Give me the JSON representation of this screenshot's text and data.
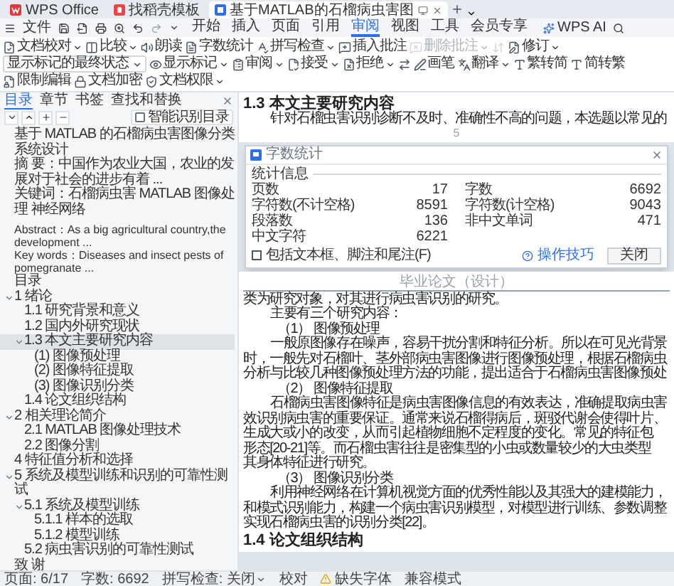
{
  "tabs": [
    {
      "kind": "home",
      "label": "WPS Office",
      "selected": false
    },
    {
      "kind": "template",
      "label": "找稻壳模板",
      "selected": false
    },
    {
      "kind": "doc",
      "label": "基于MATLAB的石榴病虫害图",
      "selected": true
    }
  ],
  "menu": {
    "file": "文件",
    "tabs": [
      {
        "label": "开始",
        "selected": false
      },
      {
        "label": "插入",
        "selected": false
      },
      {
        "label": "页面",
        "selected": false
      },
      {
        "label": "引用",
        "selected": false
      },
      {
        "label": "审阅",
        "selected": true
      },
      {
        "label": "视图",
        "selected": false
      },
      {
        "label": "工具",
        "selected": false
      },
      {
        "label": "会员专享",
        "selected": false
      }
    ],
    "ai": "WPS AI"
  },
  "ribbon": {
    "items": [
      {
        "kind": "button",
        "label": "文档校对",
        "dropdown": true,
        "disabled": false
      },
      {
        "kind": "button",
        "label": "比较",
        "dropdown": true,
        "disabled": false
      },
      {
        "kind": "button",
        "label": "朗读",
        "dropdown": false,
        "disabled": false
      },
      {
        "kind": "button",
        "label": "字数统计",
        "dropdown": false,
        "disabled": false
      },
      {
        "kind": "button",
        "label": "拼写检查",
        "dropdown": true,
        "disabled": false
      },
      {
        "kind": "button",
        "label": "插入批注",
        "dropdown": false,
        "disabled": false
      },
      {
        "kind": "button",
        "label": "删除批注",
        "dropdown": true,
        "disabled": true
      },
      {
        "kind": "icon",
        "disabled": true
      },
      {
        "kind": "button",
        "label": "修订",
        "dropdown": true,
        "disabled": false
      },
      {
        "kind": "select",
        "label": "显示标记的最终状态",
        "dropdown": true,
        "disabled": false
      },
      {
        "kind": "button",
        "label": "显示标记",
        "dropdown": true,
        "disabled": false
      },
      {
        "kind": "button",
        "label": "审阅",
        "dropdown": true,
        "disabled": false
      },
      {
        "kind": "button",
        "label": "接受",
        "dropdown": true,
        "disabled": false
      },
      {
        "kind": "button",
        "label": "拒绝",
        "dropdown": true,
        "disabled": false
      },
      {
        "kind": "icon",
        "disabled": false
      },
      {
        "kind": "button",
        "label": "画笔",
        "dropdown": false,
        "disabled": false
      },
      {
        "kind": "button",
        "label": "翻译",
        "dropdown": true,
        "disabled": false
      },
      {
        "kind": "button",
        "label": "繁转简",
        "dropdown": false,
        "disabled": false
      },
      {
        "kind": "button",
        "label": "简转繁",
        "dropdown": false,
        "disabled": false
      },
      {
        "kind": "button",
        "label": "限制编辑",
        "dropdown": false,
        "disabled": false
      },
      {
        "kind": "button",
        "label": "文档加密",
        "dropdown": false,
        "disabled": false
      },
      {
        "kind": "button",
        "label": "文档权限",
        "dropdown": true,
        "disabled": false
      }
    ]
  },
  "sidebar": {
    "tabs": [
      {
        "label": "目录",
        "selected": true
      },
      {
        "label": "章节",
        "selected": false
      },
      {
        "label": "书签",
        "selected": false
      },
      {
        "label": "查找和替换",
        "selected": false
      }
    ],
    "smart_toc": {
      "label": "智能识别目录",
      "checked": false
    },
    "toc": [
      {
        "kind": "cn",
        "text": "基于 MATLAB 的石榴病虫害图像分类系统设计",
        "selected": false
      },
      {
        "kind": "cn",
        "text": "摘 要：中国作为农业大国，农业的发展对于社会的进步有着 ...",
        "selected": false
      },
      {
        "kind": "cn",
        "text": "关键词：石榴病虫害 MATLAB 图像处理 神经网络",
        "selected": false
      },
      {
        "kind": "en",
        "text": "Abstract：As a big agricultural country,the development ...",
        "selected": false
      },
      {
        "kind": "en",
        "text": "Key words：Diseases and insect pests of pomegranate ...",
        "selected": false
      },
      {
        "kind": "cn",
        "text": "目录",
        "selected": false
      },
      {
        "kind": "cn",
        "text": "1 绪论",
        "selected": false,
        "expanded": true,
        "children": [
          {
            "kind": "cn",
            "text": "1.1 研究背景和意义",
            "selected": false
          },
          {
            "kind": "cn",
            "text": "1.2 国内外研究现状",
            "selected": false
          },
          {
            "kind": "cn",
            "text": "1.3 本文主要研究内容",
            "selected": true,
            "expanded": true,
            "children": [
              {
                "kind": "cn",
                "text": "(1) 图像预处理",
                "selected": false
              },
              {
                "kind": "cn",
                "text": "(2) 图像特征提取",
                "selected": false
              },
              {
                "kind": "cn",
                "text": "(3) 图像识别分类",
                "selected": false
              }
            ]
          },
          {
            "kind": "cn",
            "text": "1.4 论文组织结构",
            "selected": false
          }
        ]
      },
      {
        "kind": "cn",
        "text": "2 相关理论简介",
        "selected": false,
        "expanded": true,
        "children": [
          {
            "kind": "cn",
            "text": "2.1 MATLAB 图像处理技术",
            "selected": false
          },
          {
            "kind": "cn",
            "text": "2.2 图像分割",
            "selected": false
          }
        ]
      },
      {
        "kind": "cn",
        "text": "4 特征值分析和选择",
        "selected": false
      },
      {
        "kind": "cn",
        "text": "5 系统及模型训练和识别的可靠性测试",
        "selected": false,
        "expanded": true,
        "children": [
          {
            "kind": "cn",
            "text": "5.1 系统及模型训练",
            "selected": false,
            "expanded": true,
            "children": [
              {
                "kind": "cn",
                "text": "5.1.1 样本的选取",
                "selected": false
              },
              {
                "kind": "cn",
                "text": "5.1.2 模型训练",
                "selected": false
              }
            ]
          },
          {
            "kind": "cn",
            "text": "5.2 病虫害识别的可靠性测试",
            "selected": false
          }
        ]
      },
      {
        "kind": "cn",
        "text": "致 谢",
        "selected": false
      }
    ]
  },
  "document": {
    "pages": [
      {
        "blocks": [
          {
            "kind": "heading",
            "text": "1.3 本文主要研究内容"
          },
          {
            "kind": "first",
            "text": "针对石榴虫害识别诊断不及时、准确性不高的问题，本选题以常见的"
          }
        ],
        "page_number": "5"
      },
      {
        "header": "毕业论文（设计）",
        "blocks": [
          {
            "kind": "line",
            "text": "类为研究对象，对其进行病虫害识别的研究。"
          },
          {
            "kind": "first",
            "text": "主要有三个研究内容："
          },
          {
            "kind": "item",
            "text": "（1） 图像预处理"
          },
          {
            "kind": "first",
            "text": "一般原图像存在噪声，容易干扰分割和特征分析。所以在可见光背景"
          },
          {
            "kind": "line",
            "text": "时，一般先对石榴叶、茎外部病虫害图像进行图像预处理，根据石榴病虫"
          },
          {
            "kind": "line",
            "text": "分析与比较几种图像预处理方法的功能，提出适合于石榴病虫害图像预处"
          },
          {
            "kind": "item",
            "text": "（2） 图像特征提取"
          },
          {
            "kind": "first",
            "text": "石榴病虫害图像特征是病虫害图像信息的有效表达，准确提取病虫害"
          },
          {
            "kind": "line",
            "text": "效识别病虫害的重要保证。通常来说石榴得病后，斑驳代谢会使得叶片、"
          },
          {
            "kind": "line",
            "text": "生成大或小的改变，从而引起植物细胞不定程度的变化。常见的特征包"
          },
          {
            "kind": "line",
            "text": "形态[20-21]等。而石榴虫害往往是密集型的小虫或数量较少的大虫类型"
          },
          {
            "kind": "line",
            "text": "其身体特征进行研究。"
          },
          {
            "kind": "item",
            "text": "（3） 图像识别分类"
          },
          {
            "kind": "first",
            "text": "利用神经网络在计算机视觉方面的优秀性能以及其强大的建模能力，"
          },
          {
            "kind": "line",
            "text": "和模式识别能力，构建一个病虫害识别模型，对模型进行训练、参数调整"
          },
          {
            "kind": "line",
            "text": "实现石榴病虫害的识别分类[22]。"
          },
          {
            "kind": "heading",
            "text": "1.4 论文组织结构"
          }
        ]
      }
    ]
  },
  "dialog": {
    "title": "字数统计",
    "group": "统计信息",
    "stats": [
      {
        "label": "页数",
        "value": "17"
      },
      {
        "label": "字数",
        "value": "6692"
      },
      {
        "label": "字符数(不计空格)",
        "value": "8591"
      },
      {
        "label": "字符数(计空格)",
        "value": "9043"
      },
      {
        "label": "段落数",
        "value": "136"
      },
      {
        "label": "非中文单词",
        "value": "471"
      },
      {
        "label": "中文字符",
        "value": "6221"
      }
    ],
    "include_notes": {
      "label": "包括文本框、脚注和尾注(F)",
      "checked": false
    },
    "tips": "操作技巧",
    "close": "关闭"
  },
  "status_bar": {
    "items": [
      {
        "kind": "text",
        "text": "页面: 6/17"
      },
      {
        "kind": "text",
        "text": "字数: 6692"
      },
      {
        "kind": "dropdown",
        "text": "拼写检查: 关闭"
      },
      {
        "kind": "text",
        "text": "校对"
      },
      {
        "kind": "warning",
        "text": "缺失字体"
      },
      {
        "kind": "text",
        "text": "兼容模式"
      }
    ]
  }
}
